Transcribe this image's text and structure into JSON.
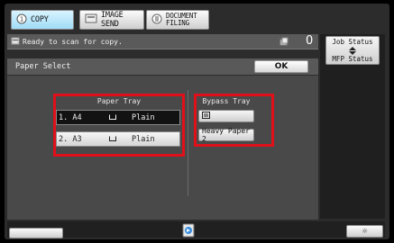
{
  "tabs": [
    {
      "label": "COPY"
    },
    {
      "label": "IMAGE SEND"
    },
    {
      "label_line1": "DOCUMENT",
      "label_line2": "FILING"
    }
  ],
  "status": {
    "message": "Ready to scan for copy.",
    "copies": "0"
  },
  "side": {
    "job_status": "Job Status",
    "mfp_status": "MFP Status"
  },
  "screen": {
    "title": "Paper Select",
    "ok_label": "OK"
  },
  "paper_tray": {
    "label": "Paper Tray",
    "items": [
      {
        "name": "1. A4",
        "type": "Plain",
        "selected": true
      },
      {
        "name": "2. A3",
        "type": "Plain",
        "selected": false
      }
    ]
  },
  "bypass_tray": {
    "label": "Bypass Tray",
    "items": [
      {
        "name": ""
      },
      {
        "name": "Heavy Paper 2"
      }
    ]
  },
  "colors": {
    "highlight": "#e0101a",
    "active_tab": "#aee2f8"
  }
}
